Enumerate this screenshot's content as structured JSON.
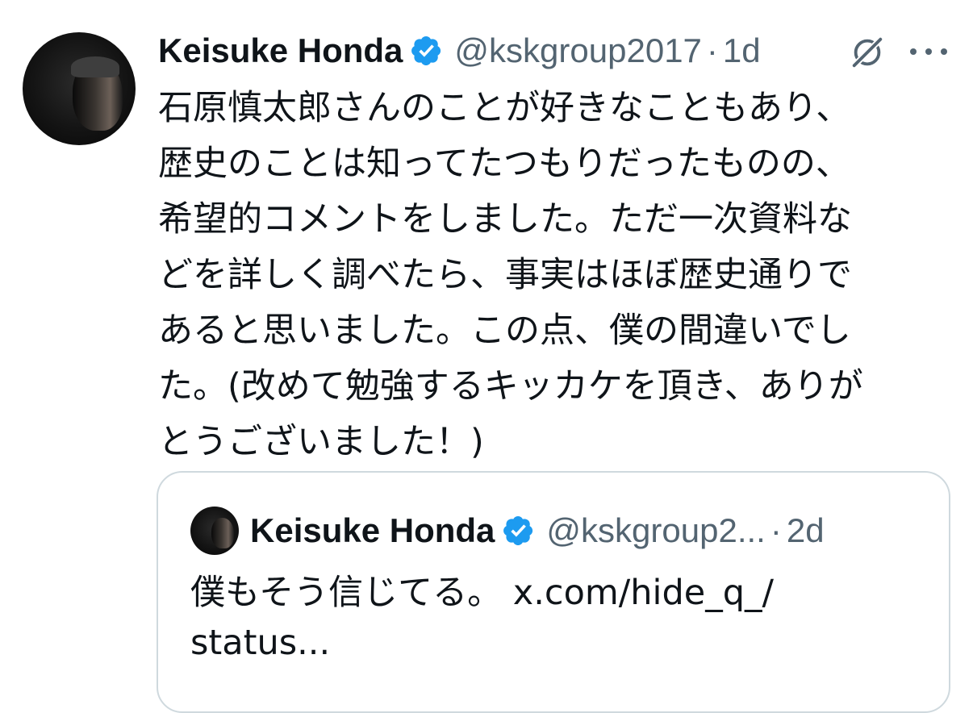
{
  "tweet": {
    "author": {
      "name": "Keisuke Honda",
      "handle": "@kskgroup2017",
      "verified": true,
      "avatar_icon": "profile-photo"
    },
    "separator": "·",
    "time": "1d",
    "actions": {
      "grok_icon": "grok-icon",
      "more_icon": "more-icon"
    },
    "text_lines": [
      "石原慎太郎さんのことが好きなこともあり、",
      "歴史のことは知ってたつもりだったものの、",
      "希望的コメントをしました。ただ一次資料な",
      "どを詳しく調べたら、事実はほぼ歴史通りで",
      "あると思いました。この点、僕の間違いでし",
      "た。(改めて勉強するキッカケを頂き、ありが",
      "とうございました！)"
    ]
  },
  "quoted_tweet": {
    "author": {
      "name": "Keisuke Honda",
      "handle": "@kskgroup2...",
      "verified": true
    },
    "separator": "·",
    "time": "2d",
    "text_lines": [
      "僕もそう信じてる。 x.com/hide_q_/",
      "status..."
    ]
  },
  "colors": {
    "text": "#0f1419",
    "secondary": "#536471",
    "verified_badge": "#1d9bf0",
    "border": "#cfd9de"
  }
}
